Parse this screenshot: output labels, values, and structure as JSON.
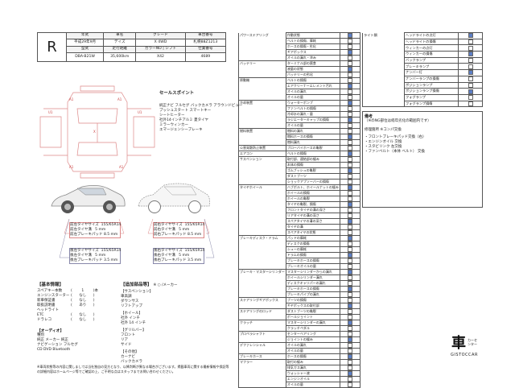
{
  "header": {
    "labels": [
      "評価点",
      "年式",
      "車名",
      "グレード",
      "車台番号"
    ],
    "grade": "R",
    "year": "平成29年9月",
    "model_name": "デイズ",
    "grade_name": "X 4WD",
    "vin_label": "札幌88Z1213",
    "row2_labels": [
      "型式",
      "走行距離",
      "カラーNO",
      "シフト",
      "仕業番号"
    ],
    "model_code": "DBA-B21W",
    "mileage": "35,600km",
    "color_no": "X42",
    "shift": "AT",
    "job_no": "4689"
  },
  "selling_points": {
    "title": "セールスポイント",
    "lines": [
      "純正ナビ  フルセグ  バックカメラ  アラウンドビュー",
      "プッシュスタート  スマートキー",
      "シートヒーター",
      "社外14インチアルミ  夏タイヤ",
      "ミラーウィンカー",
      "エマージェンシーブレーキ"
    ]
  },
  "tires": {
    "front_left": [
      "前左タイヤサイズ",
      "155/65R14",
      "前左タイヤ溝",
      "5",
      "mm",
      "前左ブレーキパッド",
      "8.5",
      "mm"
    ],
    "front_right": [
      "前右タイヤサイズ",
      "155/65R14",
      "前右タイヤ溝",
      "5",
      "mm",
      "前右ブレーキパッド",
      "8.5",
      "mm"
    ],
    "rear_left": [
      "後左タイヤサイズ",
      "155/65R14",
      "後左タイヤ溝",
      "5",
      "mm",
      "後左ブレーキパッド",
      "3.5",
      "mm"
    ],
    "rear_right": [
      "後右タイヤサイズ",
      "155/65R14",
      "後右タイヤ溝",
      "5",
      "mm",
      "後右ブレーキパッド",
      "3.5",
      "mm"
    ]
  },
  "basic": {
    "title": "【基本情報】",
    "items": [
      [
        "スペアキー本数",
        "1",
        "本"
      ],
      [
        "エンジンスターター",
        "なし",
        ""
      ],
      [
        "新車保証書",
        "なし",
        ""
      ],
      [
        "取扱説明書",
        "あり",
        ""
      ],
      [
        "ヘッドライト",
        "",
        ""
      ],
      [
        "ETC",
        "なし",
        ""
      ],
      [
        "ドラレコ",
        "なし",
        ""
      ]
    ],
    "option_title": "【オーディオ】",
    "option_lines": [
      "種別",
      "純正    メーカー    純正",
      "ナビゲーション    フルセグ",
      "CD  DVD  Bluetooth"
    ]
  },
  "extra": {
    "title": "【追加部品等】",
    "legend": "※  ○  /メーカー",
    "mt_title": "【サスペンション】",
    "items": [
      "車高調",
      "ダウンサス",
      "リフトアップ"
    ],
    "wheel_title": "【ホイール】",
    "wheel_lines": [
      "社外   インチ",
      "社外   14   インチ"
    ],
    "gl_title": "【グリルバー】",
    "gl_lines": [
      "フロント",
      "リア",
      "サイド"
    ],
    "other_title": "【その他】",
    "other_lines": [
      "カーナビ",
      "バックカメラ"
    ]
  },
  "footnote": "※車両状態等の内容に関しましては当社独自の見方となり、以降判断が異なる場合がございます。掲載車両に関する最新情報や保証等の詳細内容はホームページ等でご確認の上、ご不明な点はスタッフまでお問い合わせください。",
  "checklist_left": [
    [
      "パワーステアリング",
      "作動状態",
      ""
    ],
    [
      "",
      "ベルトの損傷、摩耗",
      ""
    ],
    [
      "",
      "ホースの損傷・劣化",
      ""
    ],
    [
      "",
      "ギアボックス",
      ""
    ],
    [
      "",
      "オイルの漏れ・滲み",
      ""
    ],
    [
      "バッテリー",
      "ターミナル部の腐食",
      ""
    ],
    [
      "",
      "液量の状態",
      ""
    ],
    [
      "",
      "バッテリーの劣化",
      ""
    ],
    [
      "原動機",
      "ベルトの損傷",
      ""
    ],
    [
      "",
      "エアクリーナーエレメント汚れ",
      ""
    ],
    [
      "",
      "オイルの漏れ",
      ""
    ],
    [
      "",
      "オイルの量",
      ""
    ],
    [
      "冷却装置",
      "ウォーターポンプ",
      ""
    ],
    [
      "",
      "ファンベルトの損傷",
      ""
    ],
    [
      "",
      "冷却水の漏れ・量",
      ""
    ],
    [
      "",
      "ラジエーターキャップの損傷",
      ""
    ],
    [
      "",
      "オイルの量",
      ""
    ],
    [
      "燃料装置",
      "燃料の漏れ",
      ""
    ],
    [
      "",
      "燃料ホースの損傷",
      ""
    ],
    [
      "",
      "燃料漏れ",
      ""
    ],
    [
      "公害発散防止装置",
      "ブローバイホースの亀裂",
      ""
    ],
    [
      "エアコン",
      "ベルトの損傷",
      ""
    ],
    [
      "サスペンション",
      "取付部、連結部の緩み",
      ""
    ],
    [
      "",
      "本体の損傷",
      ""
    ],
    [
      "",
      "ゴムブッシュの亀裂",
      ""
    ],
    [
      "",
      "ダストブーツ",
      ""
    ],
    [
      "",
      "ショックアブソーバーの損傷",
      ""
    ],
    [
      "タイヤホイール",
      "ハブボルト、ホイールナットの緩み",
      ""
    ],
    [
      "",
      "ホイールの損傷",
      ""
    ],
    [
      "",
      "ホイールの亀裂",
      ""
    ],
    [
      "",
      "タイヤの亀裂、損傷",
      ""
    ],
    [
      "",
      "フロントタイヤの溝の深さ",
      ""
    ],
    [
      "",
      "リアタイヤの溝の深さ",
      ""
    ],
    [
      "",
      "スペアタイヤの溝の深さ",
      ""
    ],
    [
      "",
      "タイヤの溝",
      ""
    ],
    [
      "",
      "スペアタイヤの状態",
      ""
    ],
    [
      "ブレーキディスク・ドラム",
      "パッドの摩耗",
      ""
    ],
    [
      "",
      "ディスクの損傷",
      ""
    ],
    [
      "",
      "シューの摩耗",
      ""
    ],
    [
      "",
      "ドラムの損傷",
      ""
    ],
    [
      "",
      "ブレーキホースの損傷",
      ""
    ],
    [
      "",
      "ブレーキオイルの量",
      ""
    ],
    [
      "ブレーキ・マスターシリンダー",
      "マスターシリンダーからの漏れ",
      ""
    ],
    [
      "",
      "ホイールシリンダー漏れ",
      ""
    ],
    [
      "",
      "ディスクキャリパーの漏れ",
      ""
    ],
    [
      "",
      "ブレーキホースの損傷",
      ""
    ],
    [
      "",
      "ブレーキパイプの漏れ",
      ""
    ],
    [
      "ステアリングギアボックス",
      "ブーツの損傷",
      ""
    ],
    [
      "",
      "ギヤボックスの取付部",
      ""
    ],
    [
      "ステアリングのロッド",
      "ダストブーツの亀裂",
      ""
    ],
    [
      "",
      "ボールジョイント",
      ""
    ],
    [
      "クラッチ",
      "マスターシリンダーの漏れ",
      ""
    ],
    [
      "",
      "クラッチペダル",
      ""
    ],
    [
      "プロペラシャフト",
      "センターベアリング",
      ""
    ],
    [
      "",
      "ジョイントの緩み",
      ""
    ],
    [
      "デファレンシャル",
      "オイルの漏れ",
      ""
    ],
    [
      "",
      "オイルの量",
      ""
    ],
    [
      "ブレーキホース",
      "ホースの損傷",
      ""
    ],
    [
      "マフラー",
      "取付の緩み",
      ""
    ],
    [
      "",
      "排気ガス漏れ",
      ""
    ],
    [
      "",
      "ウォッシャー液",
      ""
    ],
    [
      "",
      "エンジンオイル",
      ""
    ],
    [
      "",
      "オイルの量",
      ""
    ]
  ],
  "checklist_right": [
    [
      "ライト類",
      "ヘッドライトの点灯",
      ""
    ],
    [
      "",
      "ヘッドライトの損傷",
      ""
    ],
    [
      "",
      "ウィンカーの点灯",
      ""
    ],
    [
      "",
      "ウィンカーの損傷",
      ""
    ],
    [
      "",
      "バックランプ",
      ""
    ],
    [
      "",
      "ブレーキランプ",
      ""
    ],
    [
      "",
      "ナンバー灯",
      ""
    ],
    [
      "",
      "ナンバーランプの損傷",
      ""
    ],
    [
      "",
      "ポジションランプ",
      ""
    ],
    [
      "",
      "ポジションランプ損傷",
      ""
    ],
    [
      "",
      "フォグランプ",
      ""
    ],
    [
      "",
      "フォグランプ損傷",
      ""
    ]
  ],
  "remarks": {
    "title": "備考",
    "text": "（※のNG部位は経年劣化の範囲内です）",
    "sub": "修理箇所  ※コンパ交換",
    "lines": [
      "・フロントブレーキパッド交換（右）",
      "・エンジンオイル  交換",
      "・スタビリンク  左交換",
      "・ファンベルト（本体  ベルト）  交換"
    ]
  },
  "logo": {
    "main": "車",
    "small": "カーセンター",
    "brand": "GISTOCCAR"
  }
}
